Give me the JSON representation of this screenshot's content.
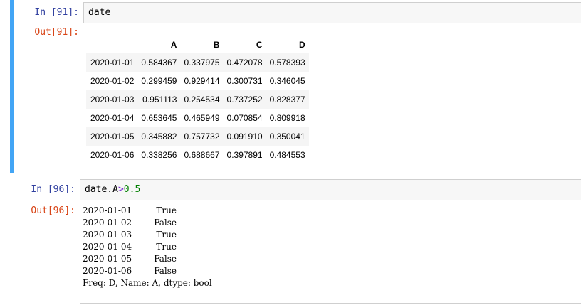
{
  "cell1": {
    "in_prompt": "In  [91]:",
    "code": "date",
    "out_prompt": "Out[91]:",
    "table": {
      "columns": [
        "A",
        "B",
        "C",
        "D"
      ],
      "rows": [
        {
          "index": "2020-01-01",
          "values": [
            "0.584367",
            "0.337975",
            "0.472078",
            "0.578393"
          ]
        },
        {
          "index": "2020-01-02",
          "values": [
            "0.299459",
            "0.929414",
            "0.300731",
            "0.346045"
          ]
        },
        {
          "index": "2020-01-03",
          "values": [
            "0.951113",
            "0.254534",
            "0.737252",
            "0.828377"
          ]
        },
        {
          "index": "2020-01-04",
          "values": [
            "0.653645",
            "0.465949",
            "0.070854",
            "0.809918"
          ]
        },
        {
          "index": "2020-01-05",
          "values": [
            "0.345882",
            "0.757732",
            "0.091910",
            "0.350041"
          ]
        },
        {
          "index": "2020-01-06",
          "values": [
            "0.338256",
            "0.688667",
            "0.397891",
            "0.484553"
          ]
        }
      ]
    }
  },
  "cell2": {
    "in_prompt": "In  [96]:",
    "code_var": "date.A",
    "code_op": ">",
    "code_num": "0.5",
    "out_prompt": "Out[96]:",
    "series": [
      {
        "index": "2020-01-01",
        "value": "True"
      },
      {
        "index": "2020-01-02",
        "value": "False"
      },
      {
        "index": "2020-01-03",
        "value": "True"
      },
      {
        "index": "2020-01-04",
        "value": "True"
      },
      {
        "index": "2020-01-05",
        "value": "False"
      },
      {
        "index": "2020-01-06",
        "value": "False"
      }
    ],
    "footer": "Freq: D, Name: A, dtype: bool"
  },
  "colors": {
    "selected_bar": "#42a5f5",
    "in_prompt": "#303f9f",
    "out_prompt": "#d84315",
    "number": "#008000",
    "operator": "#7a2bd5"
  }
}
